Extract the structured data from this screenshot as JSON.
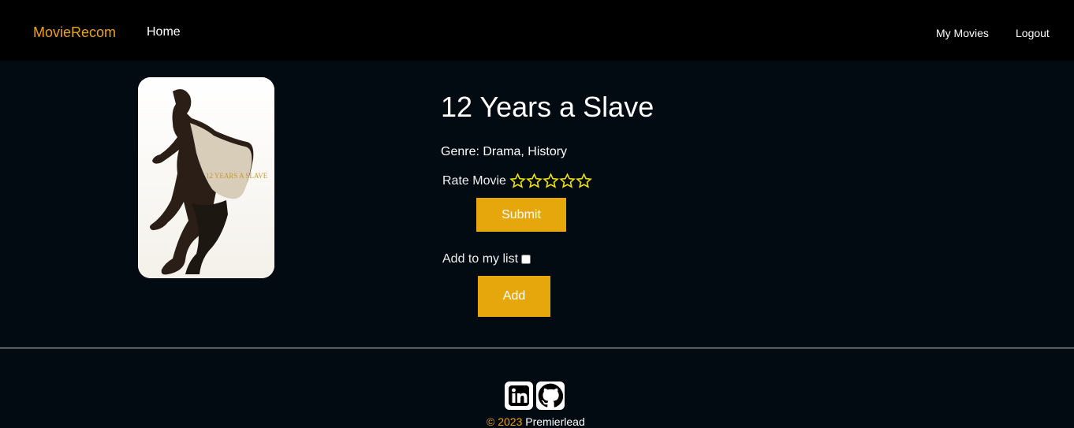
{
  "navbar": {
    "brand": "MovieRecom",
    "home": "Home",
    "my_movies": "My Movies",
    "logout": "Logout"
  },
  "movie": {
    "title": "12 Years a Slave",
    "genre": "Genre: Drama, History",
    "poster_alt": "12 Years a Slave poster",
    "poster_text": "12 YEARS A SLAVE"
  },
  "rating": {
    "label": "Rate Movie",
    "max_stars": 5,
    "selected": 0,
    "submit_label": "Submit"
  },
  "my_list": {
    "label": "Add to my list",
    "checked": false,
    "add_label": "Add"
  },
  "footer": {
    "social": [
      "linkedin-icon",
      "github-icon"
    ],
    "copyright": "© 2023",
    "owner": "Premierlead"
  },
  "colors": {
    "accent": "#e5a70b",
    "brand": "#e8a317",
    "background": "#020a12",
    "navbar": "#000000",
    "star_outline": "#f2e600"
  }
}
